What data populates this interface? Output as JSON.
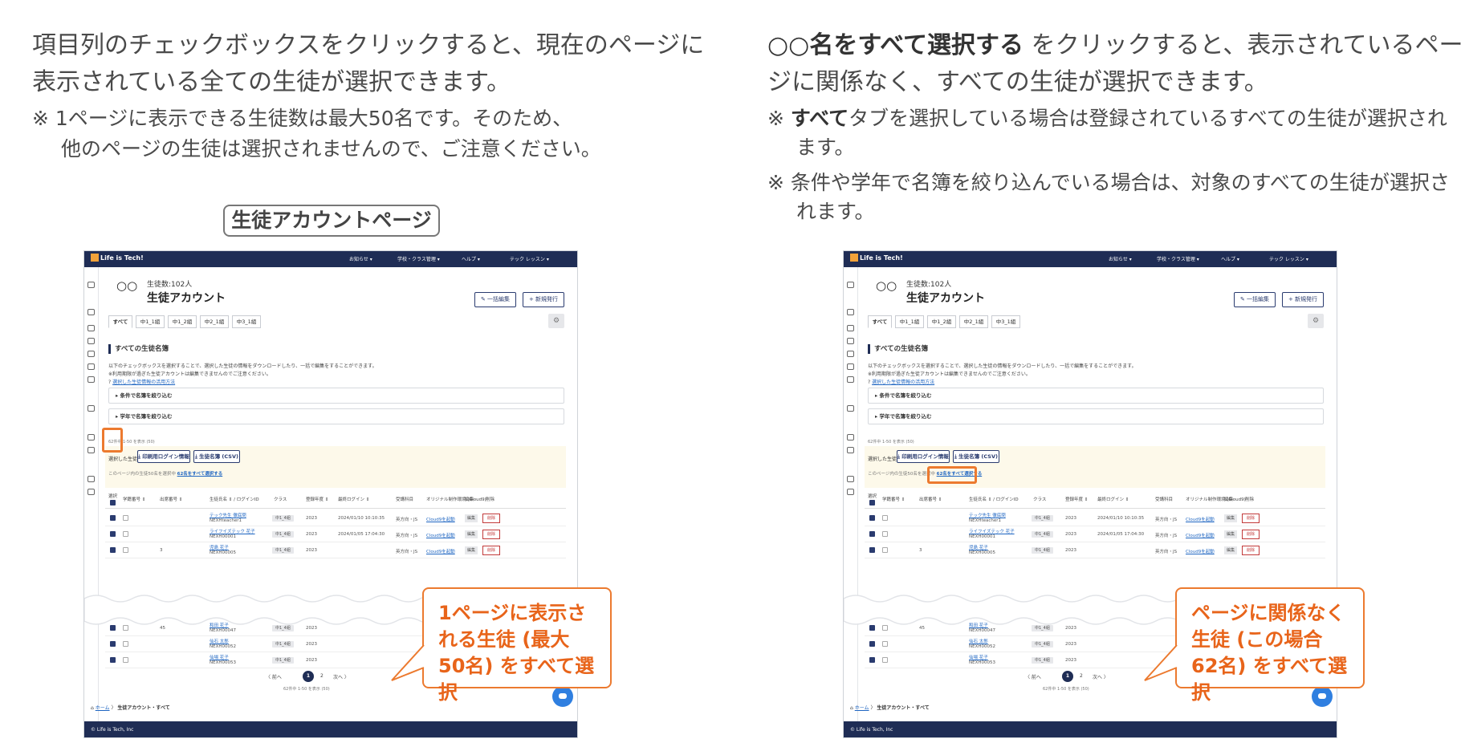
{
  "left": {
    "lead": "項目列のチェックボックスをクリックすると、現在のページに表示されている全ての生徒が選択できます。",
    "note_line1": "※ 1ページに表示できる生徒数は最大50名です。そのため、",
    "note_line2": "他のページの生徒は選択されませんので、ご注意ください。",
    "page_label": "生徒アカウントページ",
    "callout": "1ページに表示される生徒 (最大50名) をすべて選択"
  },
  "right": {
    "lead_bold": "○○名をすべて選択する",
    "lead_rest": " をクリックすると、表示されているページに関係なく、すべての生徒が選択できます。",
    "note1_prefix": "※ ",
    "note1_bold": "すべて",
    "note1_rest": "タブを選択している場合は登録されているすべての生徒が選択されます。",
    "note2": "※ 条件や学年で名簿を絞り込んでいる場合は、対象のすべての生徒が選択されます。",
    "callout": "ページに関係なく生徒 (この場合62名) をすべて選択"
  },
  "screen": {
    "logo": "Life is Tech!",
    "nav": [
      "お知らせ ▾",
      "学校・クラス管理 ▾",
      "ヘルプ ▾",
      "テック レッスン ▾"
    ],
    "student_count": "生徒数:102人",
    "page_title": "生徒アカウント",
    "bulk_edit": "✎ 一括編集",
    "new_issue": "+ 新規発行",
    "tabs": [
      "すべて",
      "中1_1組",
      "中1_2組",
      "中2_1組",
      "中3_1組"
    ],
    "section_title": "すべての生徒名簿",
    "desc_line1": "以下のチェックボックスを選択することで、選択した生徒の情報をダウンロードしたり、一括で編集をすることができます。",
    "desc_line2": "※利用期限が過ぎた生徒アカウントは編集できませんのでご注意ください。",
    "desc_link": "選択した生徒情報の活用方法",
    "filter_condition": "▸ 条件で名簿を絞り込む",
    "filter_grade": "▸ 学年で名簿を絞り込む",
    "count_note": "62件中 1-50 を表示 (50)",
    "selected_label": "選択した生徒の",
    "btn_print": "⤓ 印刷用ログイン情報",
    "btn_csv": "⤓ 生徒名簿 (CSV)",
    "select_all_prefix": "このページ内の生徒50名を選択中",
    "select_all_link": "62名をすべて選択する",
    "headers": [
      "選択",
      "学籍番号 ⇕",
      "出席番号 ⇕",
      "生徒氏名 ⇕ / ログインID",
      "クラス",
      "登録年度 ⇕",
      "最終ログイン ⇕",
      "受講科目",
      "オリジナル制作環境 (Cloud9)",
      "編集",
      "削除"
    ],
    "rows": [
      {
        "num": "",
        "name": "テック先生 徹底問",
        "id": "NEXHteacher1",
        "class": "中1_4組",
        "year": "2023",
        "login": "2024/01/10 10:10:35",
        "subject": "英方向・JS",
        "env": "Cloud9を起動"
      },
      {
        "num": "",
        "name": "ライフイズテック 花子",
        "id": "NEXH00001",
        "class": "中1_4組",
        "year": "2023",
        "login": "2024/01/05 17:04:30",
        "subject": "英方向・JS",
        "env": "Cloud9を起動"
      },
      {
        "num": "3",
        "name": "児島 花子",
        "id": "NEXH00005",
        "class": "中1_4組",
        "year": "2023",
        "login": "",
        "subject": "英方向・JS",
        "env": "Cloud9を起動"
      },
      {
        "num": "45",
        "name": "和田 花子",
        "id": "NEXH00047",
        "class": "中1_4組",
        "year": "2023",
        "login": "",
        "subject": "",
        "env": ""
      },
      {
        "num": "",
        "name": "仙石 太郎",
        "id": "NEXH00052",
        "class": "中1_4組",
        "year": "2023",
        "login": "",
        "subject": "",
        "env": ""
      },
      {
        "num": "",
        "name": "仙場 花子",
        "id": "NEXH00053",
        "class": "中1_4組",
        "year": "2023",
        "login": "",
        "subject": "",
        "env": ""
      }
    ],
    "edit": "編集",
    "delete": "削除",
    "prev": "〈 前へ",
    "page1": "1",
    "page2": "2",
    "next": "次へ 〉",
    "page_note": "62件中 1-50 を表示 (50)",
    "crumb_home": "ホーム",
    "crumb_sep": "〉",
    "crumb_current": "生徒アカウント・すべて",
    "footer": "© Life is Tech, Inc"
  },
  "colors": {
    "accent": "#ec7a2f",
    "navy": "#1f2d55",
    "link": "#1f66c2"
  }
}
